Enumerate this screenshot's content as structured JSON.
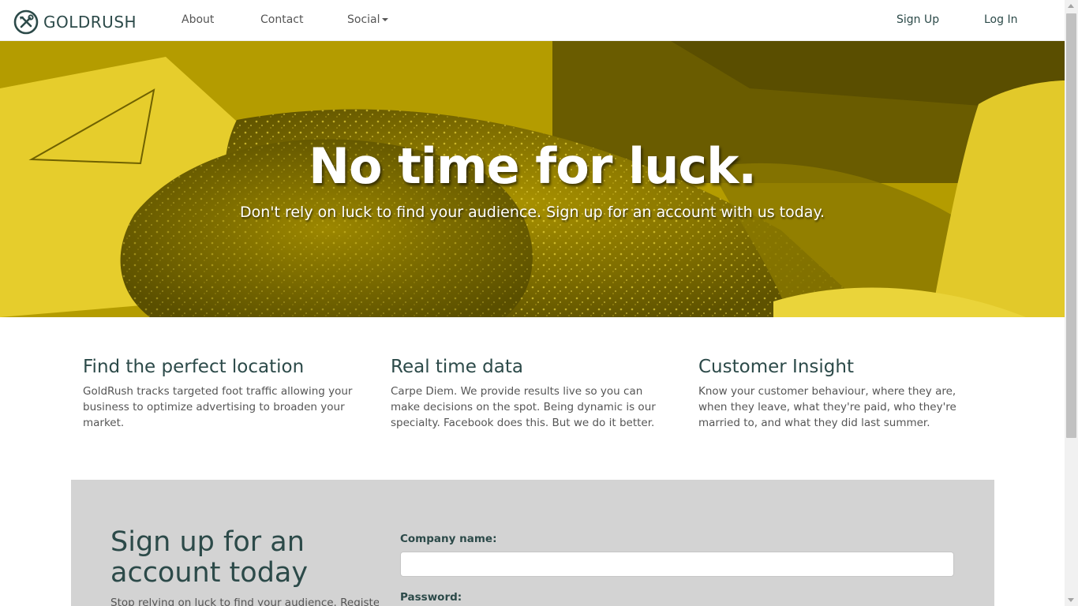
{
  "brand": {
    "name": "GOLDRUSH",
    "icon": "crossed-tools-logo-icon"
  },
  "nav": {
    "about": "About",
    "contact": "Contact",
    "social": "Social",
    "signup": "Sign Up",
    "login": "Log In"
  },
  "hero": {
    "title": "No time for luck.",
    "subtitle": "Don't rely on luck to find your audience. Sign up for an account with us today.",
    "tint_color": "#c9ad00"
  },
  "features": [
    {
      "title": "Find the perfect location",
      "text": "GoldRush tracks targeted foot traffic allowing your business to optimize advertising to broaden your market."
    },
    {
      "title": "Real time data",
      "text": "Carpe Diem. We provide results live so you can make decisions on the spot. Being dynamic is our specialty. Facebook does this. But we do it better."
    },
    {
      "title": "Customer Insight",
      "text": "Know your customer behaviour, where they are, when they leave, what they're paid, who they're married to, and what they did last summer."
    }
  ],
  "signup": {
    "title": "Sign up for an account today",
    "description": "Stop relying on luck to find your audience. Register",
    "company_label": "Company name:",
    "company_value": "",
    "password_label": "Password:"
  },
  "colors": {
    "brand_dark": "#2c4a49",
    "panel_gray": "#d3d3d3"
  }
}
